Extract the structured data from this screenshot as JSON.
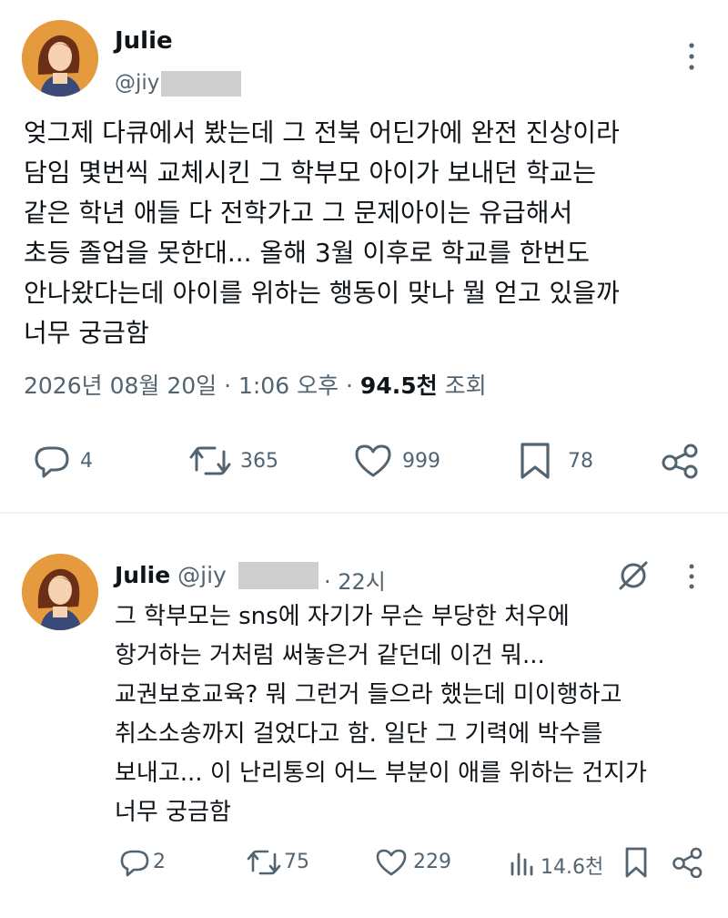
{
  "tweet": {
    "author_name": "Julie",
    "author_handle": "@jiy",
    "text": "엊그제 다큐에서 봤는데 그 전북 어딘가에 완전 진상이라\n담임 몇번씩 교체시킨 그 학부모 아이가 보내던 학교는\n같은 학년 애들 다 전학가고 그 문제아이는 유급해서\n초등 졸업을 못한대... 올해 3월 이후로 학교를 한번도\n안나왔다는데 아이를 위하는 행동이 맞나 뭘 얻고 있을까\n너무 궁금함",
    "timestamp": "2026년 08월 20일 · 1:06 오후 ·",
    "views_count": "94.5천",
    "views_label": "조회",
    "actions": {
      "replies": "4",
      "retweets": "365",
      "likes": "999",
      "bookmarks": "78"
    }
  },
  "reply": {
    "author_name": "Julie",
    "author_handle": "@jiy",
    "time": "· 22시",
    "text": "그 학부모는 sns에 자기가 무슨 부당한 처우에\n항거하는 거처럼 써놓은거 같던데 이건 뭐...\n교권보호교육? 뭐 그런거 들으라 했는데 미이행하고\n취소소송까지 걸었다고 함. 일단 그 기력에 박수를\n보내고... 이 난리통의 어느 부분이 애를 위하는 건지가\n너무 궁금함",
    "actions": {
      "replies": "2",
      "retweets": "75",
      "likes": "229",
      "views": "14.6천"
    }
  },
  "colors": {
    "text": "#0f1419",
    "muted": "#536471",
    "divider": "#eff3f4",
    "mask": "#cfcfcf"
  },
  "icons": [
    "more-icon",
    "reply-icon",
    "retweet-icon",
    "like-icon",
    "bookmark-icon",
    "share-icon",
    "grok-icon",
    "views-icon"
  ]
}
